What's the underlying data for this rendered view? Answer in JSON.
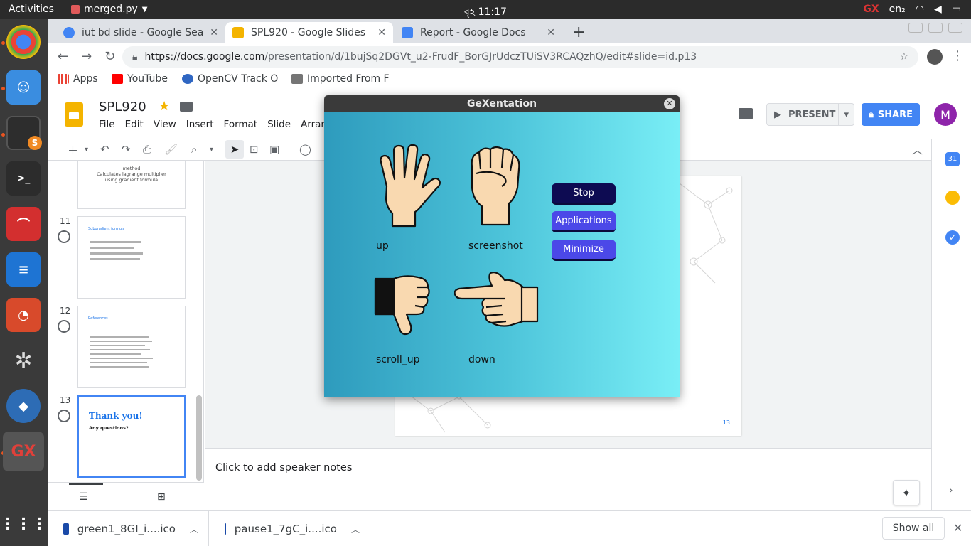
{
  "system": {
    "activities": "Activities",
    "app_name": "merged.py",
    "clock": "বৃহ 11:17",
    "lang": "en₂"
  },
  "browser": {
    "tabs": [
      {
        "label": "iut bd slide - Google Searc",
        "active": false,
        "color": "#4285f4"
      },
      {
        "label": "SPL920 - Google Slides",
        "active": true,
        "color": "#f4b400"
      },
      {
        "label": "Report - Google Docs",
        "active": false,
        "color": "#4285f4"
      }
    ],
    "url_host": "https://docs.google.com",
    "url_path": "/presentation/d/1bujSq2DGVt_u2-FrudF_BorGJrUdczTUiSV3RCAQzhQ/edit#slide=id.p13",
    "bookmarks": [
      {
        "label": "Apps",
        "icon": "apps-grid-icon"
      },
      {
        "label": "YouTube",
        "icon": "youtube-icon"
      },
      {
        "label": "OpenCV Track O",
        "icon": "opencv-icon"
      },
      {
        "label": "Imported From F",
        "icon": "folder-icon"
      }
    ]
  },
  "slides": {
    "title": "SPL920",
    "menu": [
      "File",
      "Edit",
      "View",
      "Insert",
      "Format",
      "Slide",
      "Arrange"
    ],
    "present_label": "PRESENT",
    "share_label": "SHARE",
    "avatar_letter": "M",
    "filmstrip": [
      {
        "num": "",
        "text": "method\nCalculates lagrange multiplier using gradient formula"
      },
      {
        "num": "11",
        "text": "Subgradient formula"
      },
      {
        "num": "12",
        "text": "References"
      },
      {
        "num": "13",
        "title": "Thank you!",
        "subtitle": "Any questions?"
      }
    ],
    "current_page": "13",
    "notes_placeholder": "Click to add speaker notes"
  },
  "gexentation": {
    "title": "GeXentation",
    "gestures": [
      {
        "label": "up",
        "icon": "open-palm-icon"
      },
      {
        "label": "screenshot",
        "icon": "raised-fist-icon"
      },
      {
        "label": "scroll_up",
        "icon": "thumbs-down-icon"
      },
      {
        "label": "down",
        "icon": "pointing-left-icon"
      }
    ],
    "buttons": {
      "stop": "Stop",
      "applications": "Applications",
      "minimize": "Minimize"
    },
    "colors": {
      "stop": "#0d0b52",
      "action": "#4b48e8",
      "bg_start": "#2e9bbd",
      "bg_end": "#79eef6"
    }
  },
  "downloads": {
    "items": [
      "green1_8GI_i....ico",
      "pause1_7gC_i....ico"
    ],
    "show_all": "Show all"
  }
}
